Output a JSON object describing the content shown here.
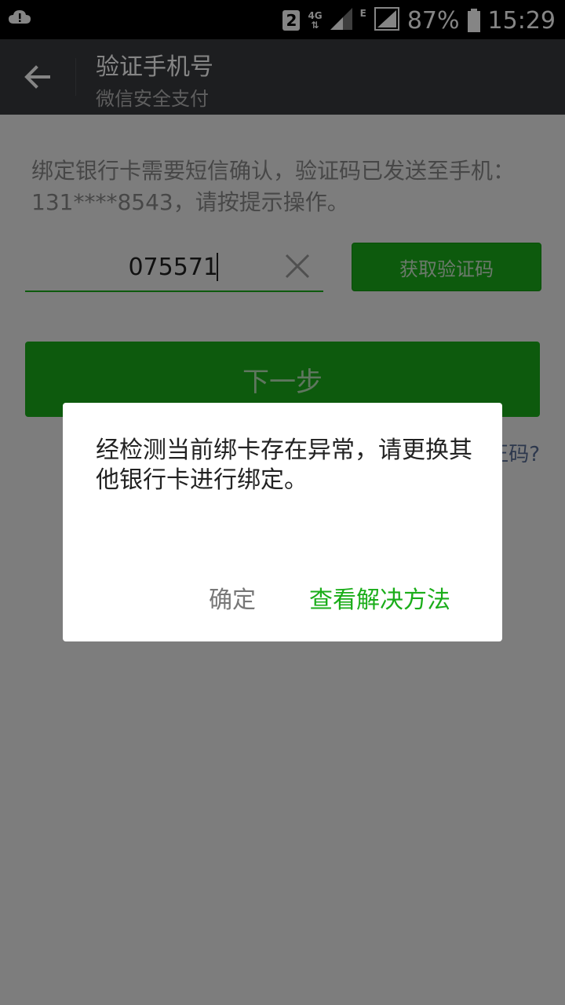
{
  "status_bar": {
    "sim_slot": "2",
    "network_type": "4G",
    "secondary_network": "E",
    "battery_percent": "87%",
    "time": "15:29"
  },
  "action_bar": {
    "title": "验证手机号",
    "subtitle": "微信安全支付",
    "back_icon": "arrow-left-icon"
  },
  "content": {
    "info_text": "绑定银行卡需要短信确认，验证码已发送至手机：131****8543，请按提示操作。",
    "code_input_value": "075571",
    "get_code_button": "获取验证码",
    "next_button": "下一步",
    "no_code_link_partial": "正码?"
  },
  "dialog": {
    "message": "经检测当前绑卡存在异常，请更换其他银行卡进行绑定。",
    "ok_button": "确定",
    "solution_button": "查看解决方法"
  },
  "colors": {
    "accent_green": "#1aad19",
    "action_bar_bg": "#393a3f",
    "link_blue": "#576b95"
  }
}
